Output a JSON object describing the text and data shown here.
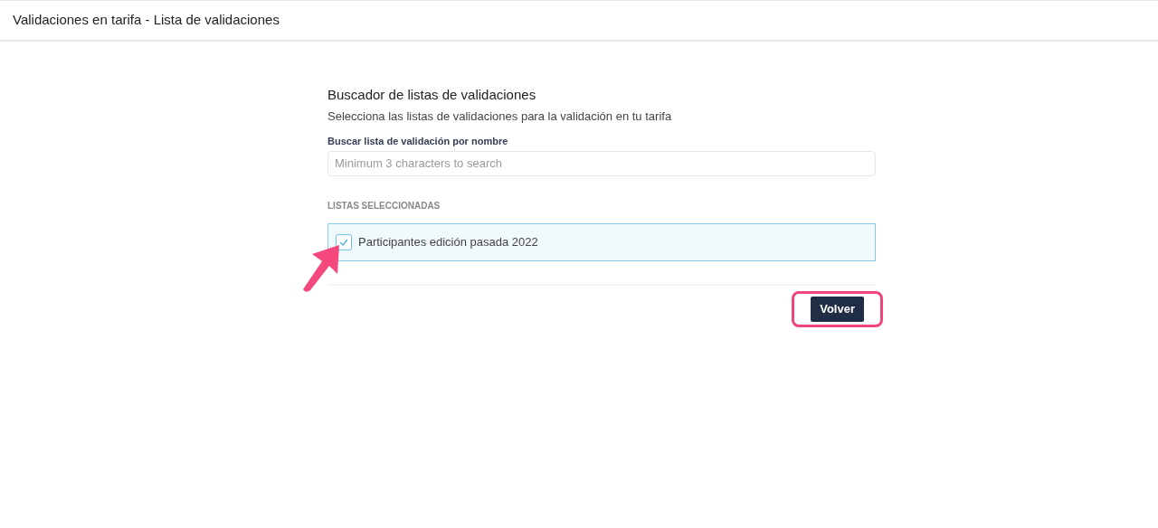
{
  "header": {
    "title": "Validaciones en tarifa - Lista de validaciones"
  },
  "search_panel": {
    "title": "Buscador de listas de validaciones",
    "subtitle": "Selecciona las listas de validaciones para la validación en tu tarifa",
    "field_label": "Buscar lista de validación por nombre",
    "placeholder": "Minimum 3 characters to search"
  },
  "selected_section": {
    "heading": "LISTAS SELECCIONADAS",
    "items": [
      {
        "label": "Participantes edición pasada 2022",
        "checked": true
      }
    ]
  },
  "buttons": [
    {
      "label": "Volver",
      "highlighted": true
    }
  ],
  "annotation": {
    "arrow_visible": true
  }
}
